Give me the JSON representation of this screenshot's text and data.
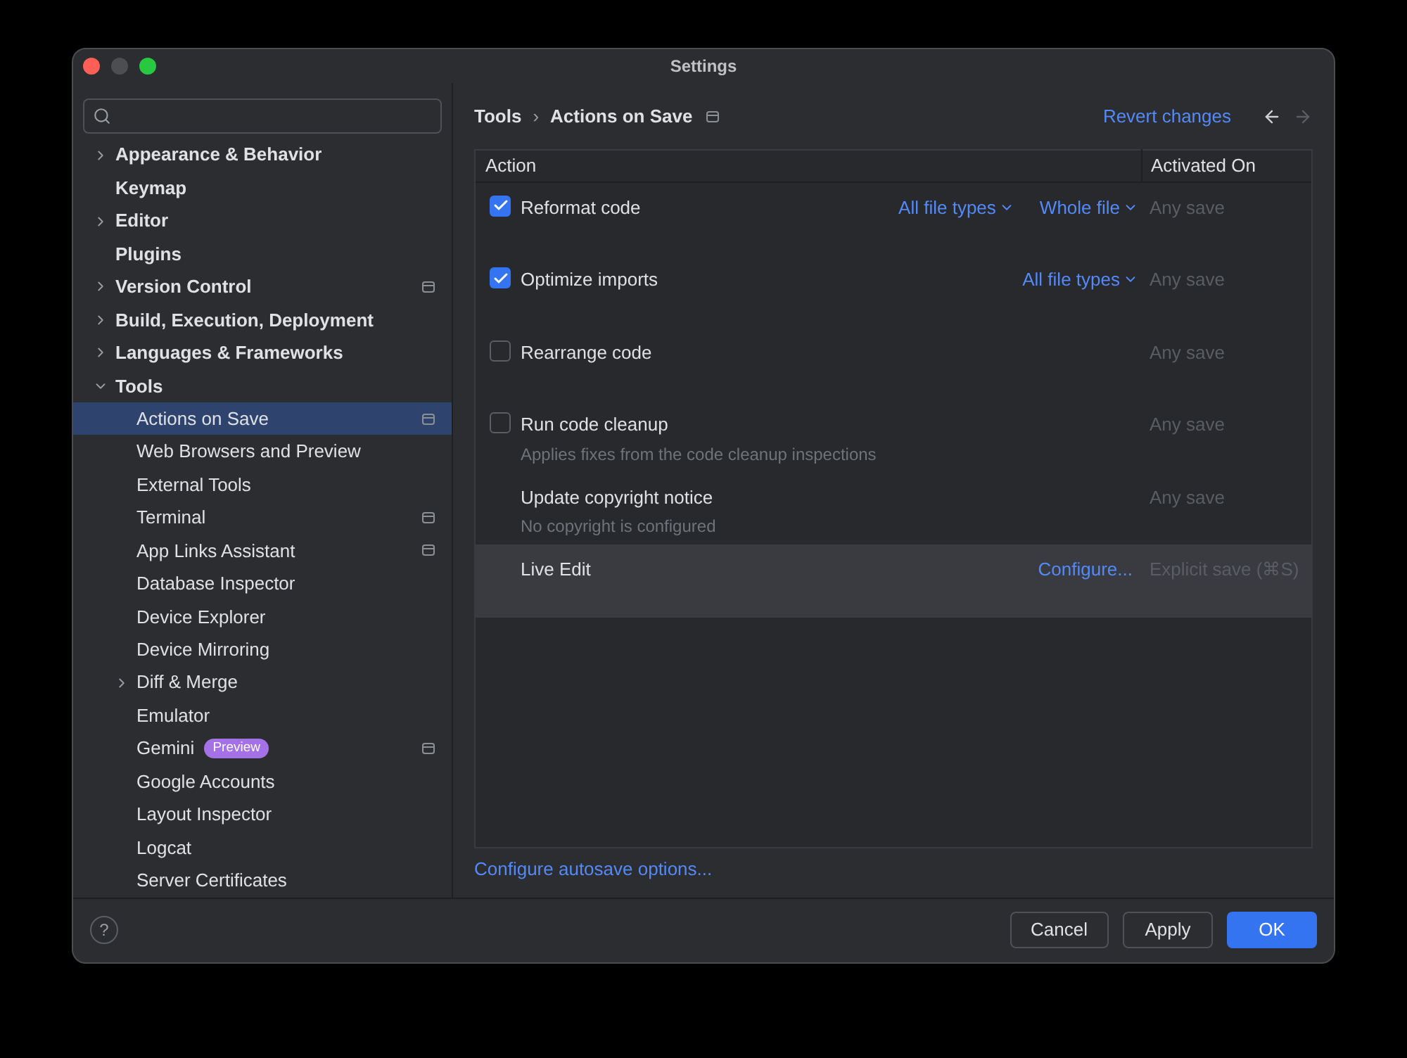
{
  "window": {
    "title": "Settings"
  },
  "help_button": "?",
  "sidebar": {
    "items": [
      {
        "label": "Appearance & Behavior",
        "kind": "group",
        "expanded": false,
        "selected": false,
        "project_icon": false
      },
      {
        "label": "Keymap",
        "kind": "page",
        "selected": false,
        "project_icon": false
      },
      {
        "label": "Editor",
        "kind": "group",
        "expanded": false,
        "selected": false,
        "project_icon": false
      },
      {
        "label": "Plugins",
        "kind": "page",
        "selected": false,
        "project_icon": false
      },
      {
        "label": "Version Control",
        "kind": "group",
        "expanded": false,
        "selected": false,
        "project_icon": true
      },
      {
        "label": "Build, Execution, Deployment",
        "kind": "group",
        "expanded": false,
        "selected": false,
        "project_icon": false
      },
      {
        "label": "Languages & Frameworks",
        "kind": "group",
        "expanded": false,
        "selected": false,
        "project_icon": false
      },
      {
        "label": "Tools",
        "kind": "group",
        "expanded": true,
        "selected": false,
        "project_icon": false,
        "children": [
          {
            "label": "Actions on Save",
            "kind": "page",
            "selected": true,
            "project_icon": true
          },
          {
            "label": "Web Browsers and Preview",
            "kind": "page",
            "selected": false,
            "project_icon": false
          },
          {
            "label": "External Tools",
            "kind": "page",
            "selected": false,
            "project_icon": false
          },
          {
            "label": "Terminal",
            "kind": "page",
            "selected": false,
            "project_icon": true
          },
          {
            "label": "App Links Assistant",
            "kind": "page",
            "selected": false,
            "project_icon": true
          },
          {
            "label": "Database Inspector",
            "kind": "page",
            "selected": false,
            "project_icon": false
          },
          {
            "label": "Device Explorer",
            "kind": "page",
            "selected": false,
            "project_icon": false
          },
          {
            "label": "Device Mirroring",
            "kind": "page",
            "selected": false,
            "project_icon": false
          },
          {
            "label": "Diff & Merge",
            "kind": "group",
            "expanded": false,
            "selected": false,
            "project_icon": false
          },
          {
            "label": "Emulator",
            "kind": "page",
            "selected": false,
            "project_icon": false
          },
          {
            "label": "Gemini",
            "kind": "page",
            "selected": false,
            "project_icon": true,
            "badge": "Preview"
          },
          {
            "label": "Google Accounts",
            "kind": "page",
            "selected": false,
            "project_icon": false
          },
          {
            "label": "Layout Inspector",
            "kind": "page",
            "selected": false,
            "project_icon": false
          },
          {
            "label": "Logcat",
            "kind": "page",
            "selected": false,
            "project_icon": false
          },
          {
            "label": "Server Certificates",
            "kind": "page",
            "selected": false,
            "project_icon": false
          }
        ]
      }
    ]
  },
  "breadcrumb": {
    "parent": "Tools",
    "separator": "›",
    "current": "Actions on Save",
    "project_icon": true
  },
  "revert_link": "Revert changes",
  "table": {
    "columns": [
      "Action",
      "Activated On"
    ],
    "rows": [
      {
        "kind": "checkbox",
        "checked": true,
        "label": "Reformat code",
        "options": [
          "All file types",
          "Whole file"
        ],
        "activated_on": "Any save",
        "highlighted": false
      },
      {
        "kind": "checkbox",
        "checked": true,
        "label": "Optimize imports",
        "options": [
          "All file types"
        ],
        "activated_on": "Any save",
        "highlighted": false
      },
      {
        "kind": "checkbox",
        "checked": false,
        "label": "Rearrange code",
        "activated_on": "Any save",
        "highlighted": false
      },
      {
        "kind": "checkbox",
        "checked": false,
        "label": "Run code cleanup",
        "description": "Applies fixes from the code cleanup inspections",
        "activated_on": "Any save",
        "highlighted": false
      },
      {
        "kind": "plain",
        "label": "Update copyright notice",
        "description": "No copyright is configured",
        "activated_on": "Any save",
        "highlighted": false
      },
      {
        "kind": "plain",
        "label": "Live Edit",
        "link": "Configure...",
        "activated_on": "Explicit save (⌘S)",
        "highlighted": true
      }
    ]
  },
  "autosave_link": "Configure autosave options...",
  "buttons": [
    {
      "label": "Cancel",
      "primary": false
    },
    {
      "label": "Apply",
      "primary": false
    },
    {
      "label": "OK",
      "primary": true
    }
  ]
}
